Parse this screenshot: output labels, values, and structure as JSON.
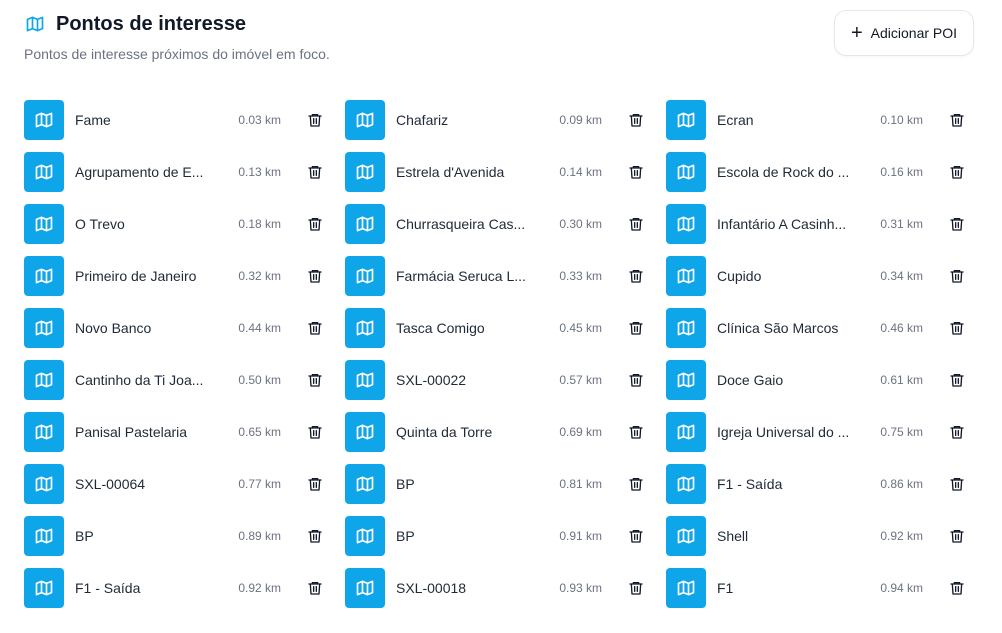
{
  "header": {
    "title": "Pontos de interesse",
    "subtitle": "Pontos de interesse próximos do imóvel em foco.",
    "title_icon": "map-icon",
    "add_button_label": "Adicionar POI",
    "add_button_icon": "plus-icon"
  },
  "colors": {
    "accent": "#0ea5e9",
    "title_icon": "#0ea5e9",
    "text": "#1f2937",
    "muted": "#6b7280"
  },
  "pois": [
    {
      "name": "Fame",
      "distance": "0.03 km"
    },
    {
      "name": "Chafariz",
      "distance": "0.09 km"
    },
    {
      "name": "Ecran",
      "distance": "0.10 km"
    },
    {
      "name": "Agrupamento de E...",
      "distance": "0.13 km"
    },
    {
      "name": "Estrela d'Avenida",
      "distance": "0.14 km"
    },
    {
      "name": "Escola de Rock do ...",
      "distance": "0.16 km"
    },
    {
      "name": "O Trevo",
      "distance": "0.18 km"
    },
    {
      "name": "Churrasqueira Cas...",
      "distance": "0.30 km"
    },
    {
      "name": "Infantário A Casinh...",
      "distance": "0.31 km"
    },
    {
      "name": "Primeiro de Janeiro",
      "distance": "0.32 km"
    },
    {
      "name": "Farmácia Seruca L...",
      "distance": "0.33 km"
    },
    {
      "name": "Cupido",
      "distance": "0.34 km"
    },
    {
      "name": "Novo Banco",
      "distance": "0.44 km"
    },
    {
      "name": "Tasca Comigo",
      "distance": "0.45 km"
    },
    {
      "name": "Clínica São Marcos",
      "distance": "0.46 km"
    },
    {
      "name": "Cantinho da Ti Joa...",
      "distance": "0.50 km"
    },
    {
      "name": "SXL-00022",
      "distance": "0.57 km"
    },
    {
      "name": "Doce Gaio",
      "distance": "0.61 km"
    },
    {
      "name": "Panisal Pastelaria",
      "distance": "0.65 km"
    },
    {
      "name": "Quinta da Torre",
      "distance": "0.69 km"
    },
    {
      "name": "Igreja Universal do ...",
      "distance": "0.75 km"
    },
    {
      "name": "SXL-00064",
      "distance": "0.77 km"
    },
    {
      "name": "BP",
      "distance": "0.81 km"
    },
    {
      "name": "F1 - Saída",
      "distance": "0.86 km"
    },
    {
      "name": "BP",
      "distance": "0.89 km"
    },
    {
      "name": "BP",
      "distance": "0.91 km"
    },
    {
      "name": "Shell",
      "distance": "0.92 km"
    },
    {
      "name": "F1 - Saída",
      "distance": "0.92 km"
    },
    {
      "name": "SXL-00018",
      "distance": "0.93 km"
    },
    {
      "name": "F1",
      "distance": "0.94 km"
    }
  ],
  "item_icon": "map-icon",
  "delete_icon": "trash-icon"
}
